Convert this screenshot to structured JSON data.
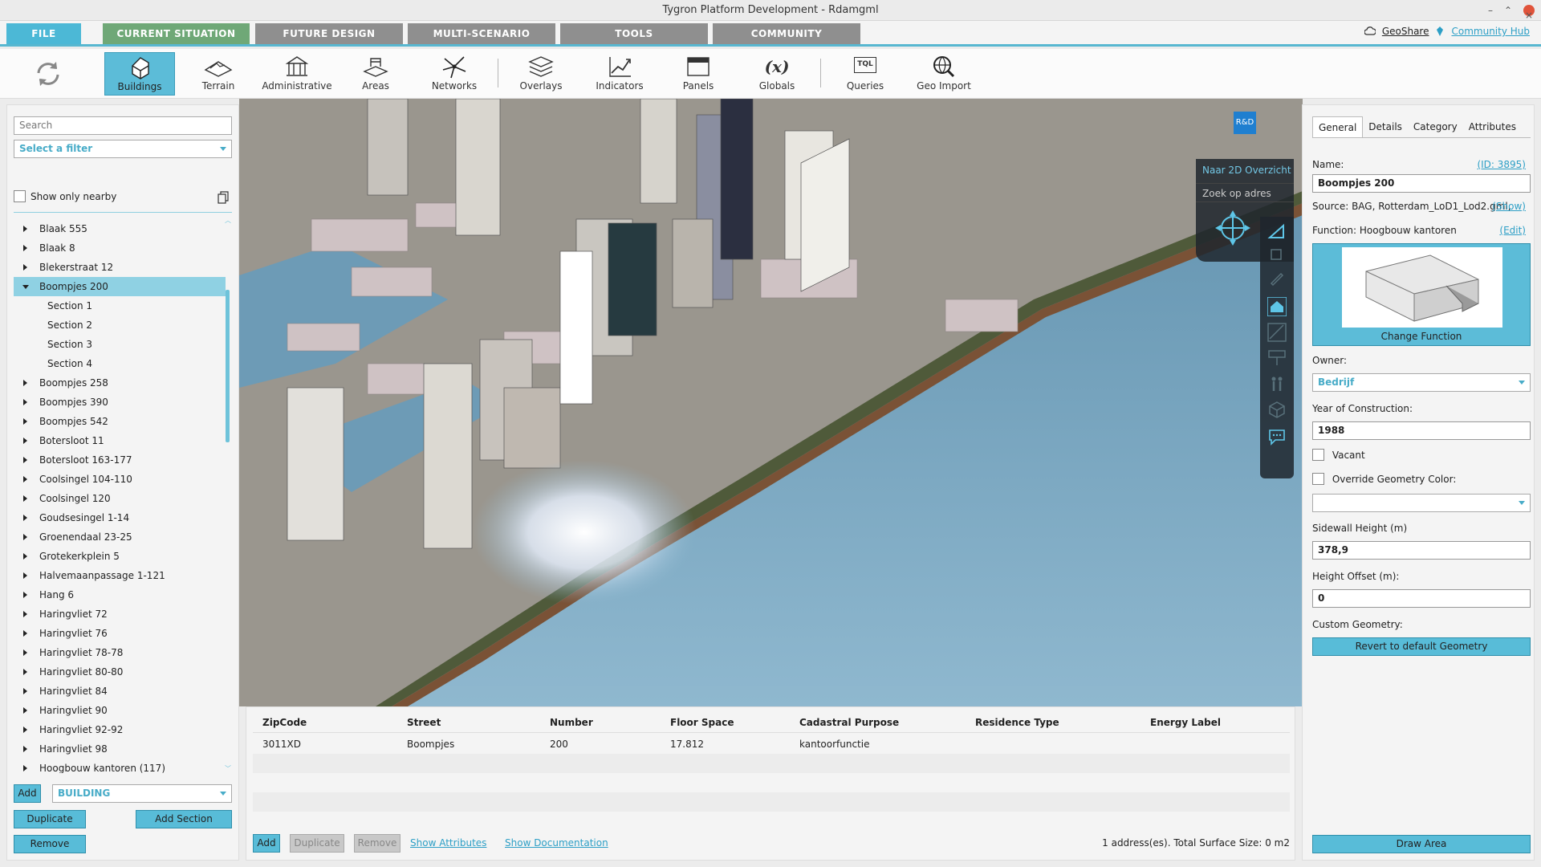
{
  "window": {
    "title": "Tygron Platform Development - Rdamgml",
    "controls": {
      "minimize": "–",
      "restore": "⌃",
      "close": "×"
    }
  },
  "menu": {
    "tabs": [
      {
        "label": "FILE"
      },
      {
        "label": "CURRENT SITUATION"
      },
      {
        "label": "FUTURE DESIGN"
      },
      {
        "label": "MULTI-SCENARIO"
      },
      {
        "label": "TOOLS"
      },
      {
        "label": "COMMUNITY"
      }
    ],
    "links": {
      "geoshare": "GeoShare",
      "hub": "Community Hub"
    },
    "colors": {
      "file": "#4cb8d6",
      "current": "#6fa877",
      "inactive": "#8f8f8f",
      "accent": "#57b7d0"
    }
  },
  "toolbar": {
    "items": [
      {
        "label": "Buildings",
        "icon": "buildings-icon"
      },
      {
        "label": "Terrain",
        "icon": "terrain-icon"
      },
      {
        "label": "Administrative",
        "icon": "administrative-icon"
      },
      {
        "label": "Areas",
        "icon": "areas-icon"
      },
      {
        "label": "Networks",
        "icon": "networks-icon"
      },
      {
        "label": "Overlays",
        "icon": "overlays-icon"
      },
      {
        "label": "Indicators",
        "icon": "indicators-icon"
      },
      {
        "label": "Panels",
        "icon": "panels-icon"
      },
      {
        "label": "Globals",
        "icon": "globals-icon"
      },
      {
        "label": "Queries",
        "icon": "queries-icon"
      },
      {
        "label": "Geo Import",
        "icon": "geo-import-icon"
      }
    ],
    "globals_symbol": "(x)",
    "queries_symbol": "TQL"
  },
  "left": {
    "search_placeholder": "Search",
    "filter": "Select a filter",
    "show_nearby": "Show only nearby",
    "tree": [
      {
        "label": "Blaak 555",
        "kind": "closed"
      },
      {
        "label": "Blaak 8",
        "kind": "closed"
      },
      {
        "label": "Blekerstraat 12",
        "kind": "closed"
      },
      {
        "label": "Boompjes 200",
        "kind": "open"
      },
      {
        "label": "Section 1",
        "kind": "child"
      },
      {
        "label": "Section 2",
        "kind": "child"
      },
      {
        "label": "Section 3",
        "kind": "child"
      },
      {
        "label": "Section 4",
        "kind": "child"
      },
      {
        "label": "Boompjes 258",
        "kind": "closed"
      },
      {
        "label": "Boompjes 390",
        "kind": "closed"
      },
      {
        "label": "Boompjes 542",
        "kind": "closed"
      },
      {
        "label": "Botersloot 11",
        "kind": "closed"
      },
      {
        "label": "Botersloot 163-177",
        "kind": "closed"
      },
      {
        "label": "Coolsingel 104-110",
        "kind": "closed"
      },
      {
        "label": "Coolsingel 120",
        "kind": "closed"
      },
      {
        "label": "Goudsesingel 1-14",
        "kind": "closed"
      },
      {
        "label": "Groenendaal 23-25",
        "kind": "closed"
      },
      {
        "label": "Grotekerkplein 5",
        "kind": "closed"
      },
      {
        "label": "Halvemaanpassage 1-121",
        "kind": "closed"
      },
      {
        "label": "Hang 6",
        "kind": "closed"
      },
      {
        "label": "Haringvliet 72",
        "kind": "closed"
      },
      {
        "label": "Haringvliet 76",
        "kind": "closed"
      },
      {
        "label": "Haringvliet 78-78",
        "kind": "closed"
      },
      {
        "label": "Haringvliet 80-80",
        "kind": "closed"
      },
      {
        "label": "Haringvliet 84",
        "kind": "closed"
      },
      {
        "label": "Haringvliet 90",
        "kind": "closed"
      },
      {
        "label": "Haringvliet 92-92",
        "kind": "closed"
      },
      {
        "label": "Haringvliet 98",
        "kind": "closed"
      },
      {
        "label": "Hoogbouw kantoren (117)",
        "kind": "closed"
      }
    ],
    "selected_index": 3,
    "add": "Add",
    "type": "BUILDING",
    "duplicate": "Duplicate",
    "add_section": "Add Section",
    "remove": "Remove"
  },
  "viewport": {
    "badge": "R&D",
    "naar_2d": "Naar 2D Overzicht",
    "zoek": "Zoek op adres"
  },
  "table": {
    "columns": [
      "ZipCode",
      "Street",
      "Number",
      "Floor Space",
      "Cadastral Purpose",
      "Residence Type",
      "Energy Label"
    ],
    "rows": [
      [
        "3011XD",
        "Boompjes",
        "200",
        "17.812",
        "kantoorfunctie",
        "",
        ""
      ]
    ],
    "add": "Add",
    "duplicate": "Duplicate",
    "remove": "Remove",
    "show_attributes": "Show Attributes",
    "show_documentation": "Show Documentation",
    "summary": "1 address(es). Total Surface Size: 0 m2"
  },
  "right": {
    "tabs": [
      "General",
      "Details",
      "Category",
      "Attributes"
    ],
    "name_label": "Name:",
    "id_link": "(ID: 3895)",
    "name_value": "Boompjes 200",
    "source": "Source: BAG, Rotterdam_LoD1_Lod2.gml,",
    "show_link": "(Show)",
    "function": "Function: Hoogbouw kantoren",
    "edit_link": "(Edit)",
    "change_function": "Change Function",
    "owner_label": "Owner:",
    "owner_value": "Bedrijf",
    "year_label": "Year of Construction:",
    "year_value": "1988",
    "vacant": "Vacant",
    "override_color": "Override Geometry Color:",
    "sidewall_label": "Sidewall Height (m)",
    "sidewall_value": "378,9",
    "offset_label": "Height Offset (m):",
    "offset_value": "0",
    "custom_geometry": "Custom Geometry:",
    "revert": "Revert to default Geometry",
    "draw_area": "Draw Area"
  }
}
